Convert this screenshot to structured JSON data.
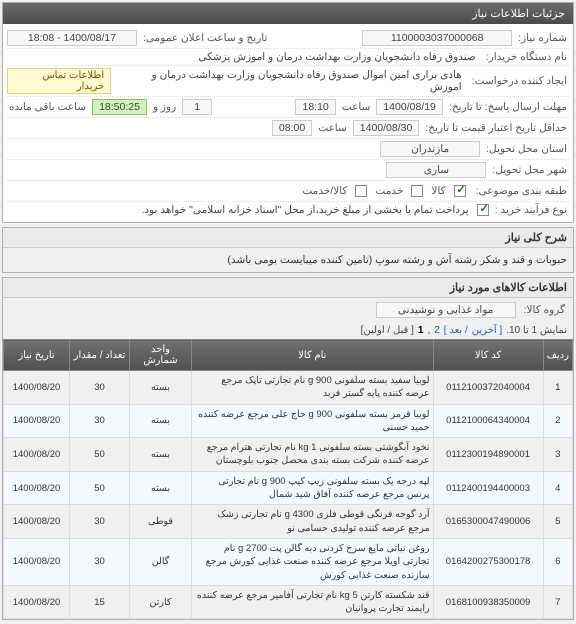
{
  "header": {
    "title": "جزئیات اطلاعات نیاز"
  },
  "info": {
    "needNumberLabel": "شماره نیاز:",
    "needNumber": "1100003037000068",
    "announceLabel": "تاریخ و ساعت اعلان عمومی:",
    "announceValue": "1400/08/17 - 18:08",
    "buyerLabel": "نام دستگاه خریدار:",
    "buyerValue": "صندوق رفاه دانشجویان وزارت بهداشت  درمان و اموزش پزشکی",
    "requesterLabel": "ایجاد کننده درخواست:",
    "requesterValue": "هادی براری امین اموال صندوق رفاه دانشجویان وزارت بهداشت  درمان و اموزش",
    "contactNote": "اطلاعات تماس خریدار",
    "deadlineLabel": "مهلت ارسال پاسخ: تا تاریخ:",
    "deadlineDate": "1400/08/19",
    "timeLabel": "ساعت",
    "deadlineTime": "18:10",
    "remainDays": "1",
    "dayAnd": "روز و",
    "remainTime": "18:50:25",
    "remainText": "ساعت باقی مانده",
    "minValidLabel": "حداقل تاریخ اعتبار قیمت تا تاریخ:",
    "minValidDate": "1400/08/30",
    "minValidTime": "08:00",
    "provinceLabel": "استان محل تحویل:",
    "provinceValue": "مازندران",
    "cityLabel": "شهر محل تحویل:",
    "cityValue": "ساری",
    "categoryLabel": "طبقه بندی موضوعی:",
    "cat1": "کالا",
    "cat2": "خدمت",
    "cat3": "کالا/خدمت",
    "buyTypeLabel": "نوع فرآیند خرید :",
    "buyTypeNote": "پرداخت تمام یا بخشی از مبلغ خرید،از محل \"اسناد خزانه اسلامی\" خواهد بود."
  },
  "desc": {
    "header": "شرح کلی نیاز",
    "text": "حبوبات و قند و شکر رشته آش و رشته سوپ (تامین کننده میبایست بومی باشد)"
  },
  "items": {
    "header": "اطلاعات کالاهای مورد نیاز",
    "groupLabel": "گروه کالا:",
    "groupValue": "مواد غذایی و نوشیدنی",
    "pagerText": "نمایش 1 تا 10.",
    "pagerLinks": {
      "last": "[ آخرین",
      "next": "/ بعد ]",
      "p2": "2",
      "p1": "1",
      "firstPrev": "[ قبل / اولین]"
    },
    "columns": {
      "idx": "ردیف",
      "code": "کد کالا",
      "name": "نام کالا",
      "unit": "واحد شمارش",
      "qty": "تعداد / مقدار",
      "date": "تاریخ نیاز"
    },
    "rows": [
      {
        "idx": "1",
        "code": "0112100372040004",
        "name": "لوبیا سفید بسته سلفونی g 900 نام تجارتی تاپک مرجع عرضه کننده پایه گستر فربد",
        "unit": "بسته",
        "qty": "30",
        "date": "1400/08/20"
      },
      {
        "idx": "2",
        "code": "0112100064340004",
        "name": "لوبیا قرمز بسته سلفونی g 900 حاج علی مرجع عرضه کننده حمید حسنی",
        "unit": "بسته",
        "qty": "30",
        "date": "1400/08/20"
      },
      {
        "idx": "3",
        "code": "0112300194890001",
        "name": "نخود آبگوشتی بسته سلفونی kg 1 نام تجارتی هترام مرجع عرضه کننده شرکت بسته بندی محصل جنوب بلوچستان",
        "unit": "بسته",
        "qty": "50",
        "date": "1400/08/20"
      },
      {
        "idx": "4",
        "code": "0112400194400003",
        "name": "لپه درجه یک بسته سلفونی زیپ کیپ g 900 نام تجارتی پرنس مرجع عرضه کننده آفاق شید شمال",
        "unit": "بسته",
        "qty": "50",
        "date": "1400/08/20"
      },
      {
        "idx": "5",
        "code": "0165300047490006",
        "name": "آرد گوجه فرنگی قوطی فلزی g 4300 نام تجارتی زشک مرجع عرضه کننده تولیدی حسامی نو",
        "unit": "قوطی",
        "qty": "30",
        "date": "1400/08/20"
      },
      {
        "idx": "6",
        "code": "0164200275300178",
        "name": "روغن نباتی مایع سرخ کردنی دبه گالن پت g 2700 نام تجارتی اویلا مرجع عرضه کننده صنعت غذایی کورش مرجع سازنده صنعت غذایی کورش",
        "unit": "گالن",
        "qty": "30",
        "date": "1400/08/20"
      },
      {
        "idx": "7",
        "code": "0168100938350009",
        "name": "قند شکسته کارتن kg 5 نام تجارتی آفامیر مرجع عرضه کننده رایمند تجارت پروانیان",
        "unit": "کارتن",
        "qty": "15",
        "date": "1400/08/20"
      }
    ]
  }
}
